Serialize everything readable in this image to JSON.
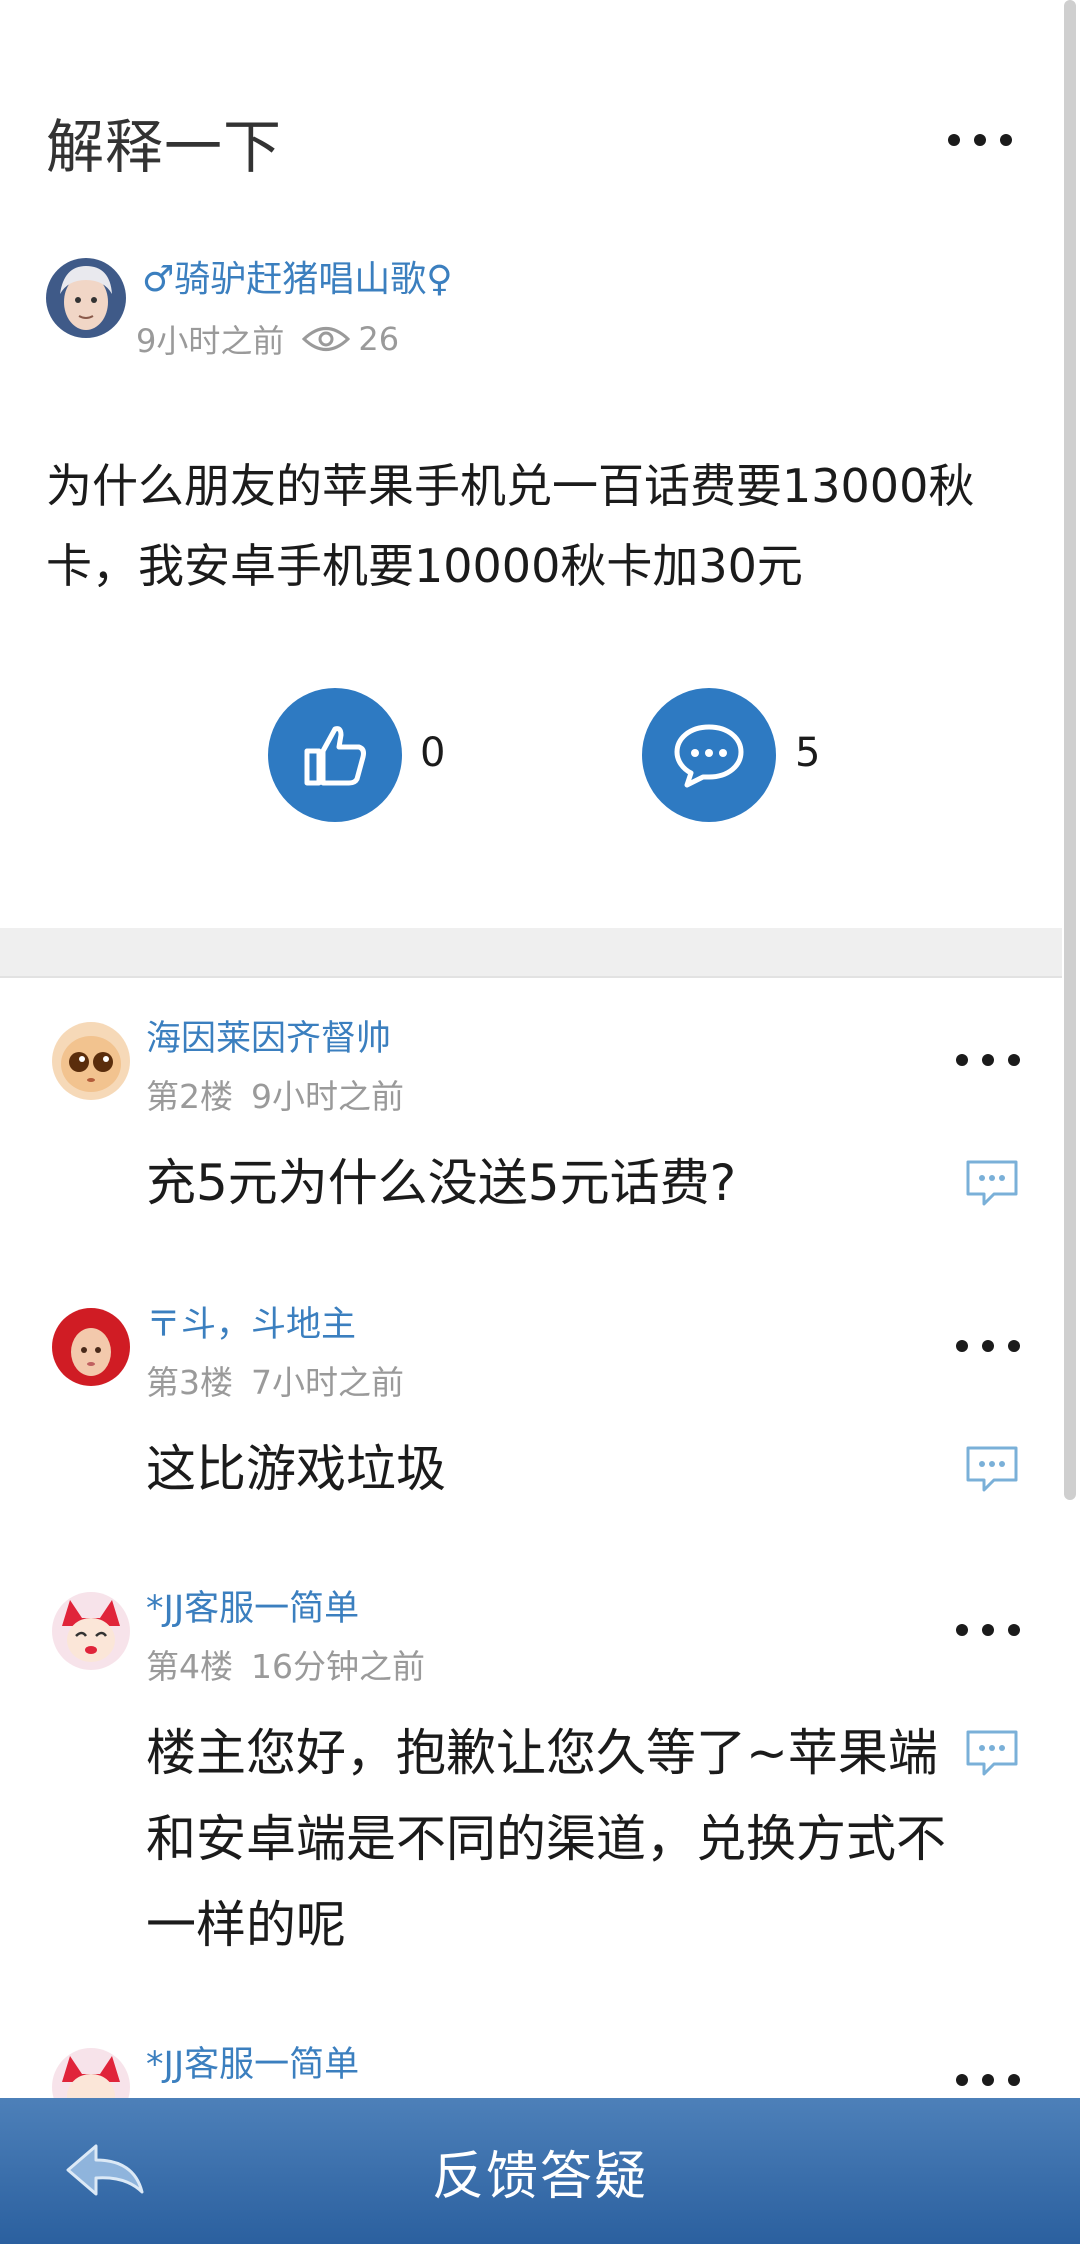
{
  "post": {
    "title": "解释一下",
    "author_name": "♂骑驴赶猪唱山歌♀",
    "time": "9小时之前",
    "views": "26",
    "body": "为什么朋友的苹果手机兑一百话费要13000秋卡，我安卓手机要10000秋卡加30元",
    "like_count": "0",
    "comment_count": "5"
  },
  "replies": [
    {
      "name": "海因莱因齐督帅",
      "floor": "第2楼",
      "time": "9小时之前",
      "text": "充5元为什么没送5元话费?"
    },
    {
      "name": "〒斗，斗地主",
      "floor": "第3楼",
      "time": "7小时之前",
      "text": "这比游戏垃圾"
    },
    {
      "name": "*JJ客服一简单",
      "floor": "第4楼",
      "time": "16分钟之前",
      "text": "楼主您好，抱歉让您久等了~苹果端和安卓端是不同的渠道，兑换方式不一样的呢"
    },
    {
      "name": "*JJ客服一简单"
    }
  ],
  "bottom_bar": {
    "title": "反馈答疑"
  },
  "colors": {
    "accent": "#2e7ac2",
    "link": "#3b7fbf",
    "bar": "#3a6dab"
  },
  "icons": [
    "more-icon",
    "eye-icon",
    "thumbs-up-icon",
    "comment-icon",
    "reply-icon",
    "back-arrow-icon"
  ]
}
